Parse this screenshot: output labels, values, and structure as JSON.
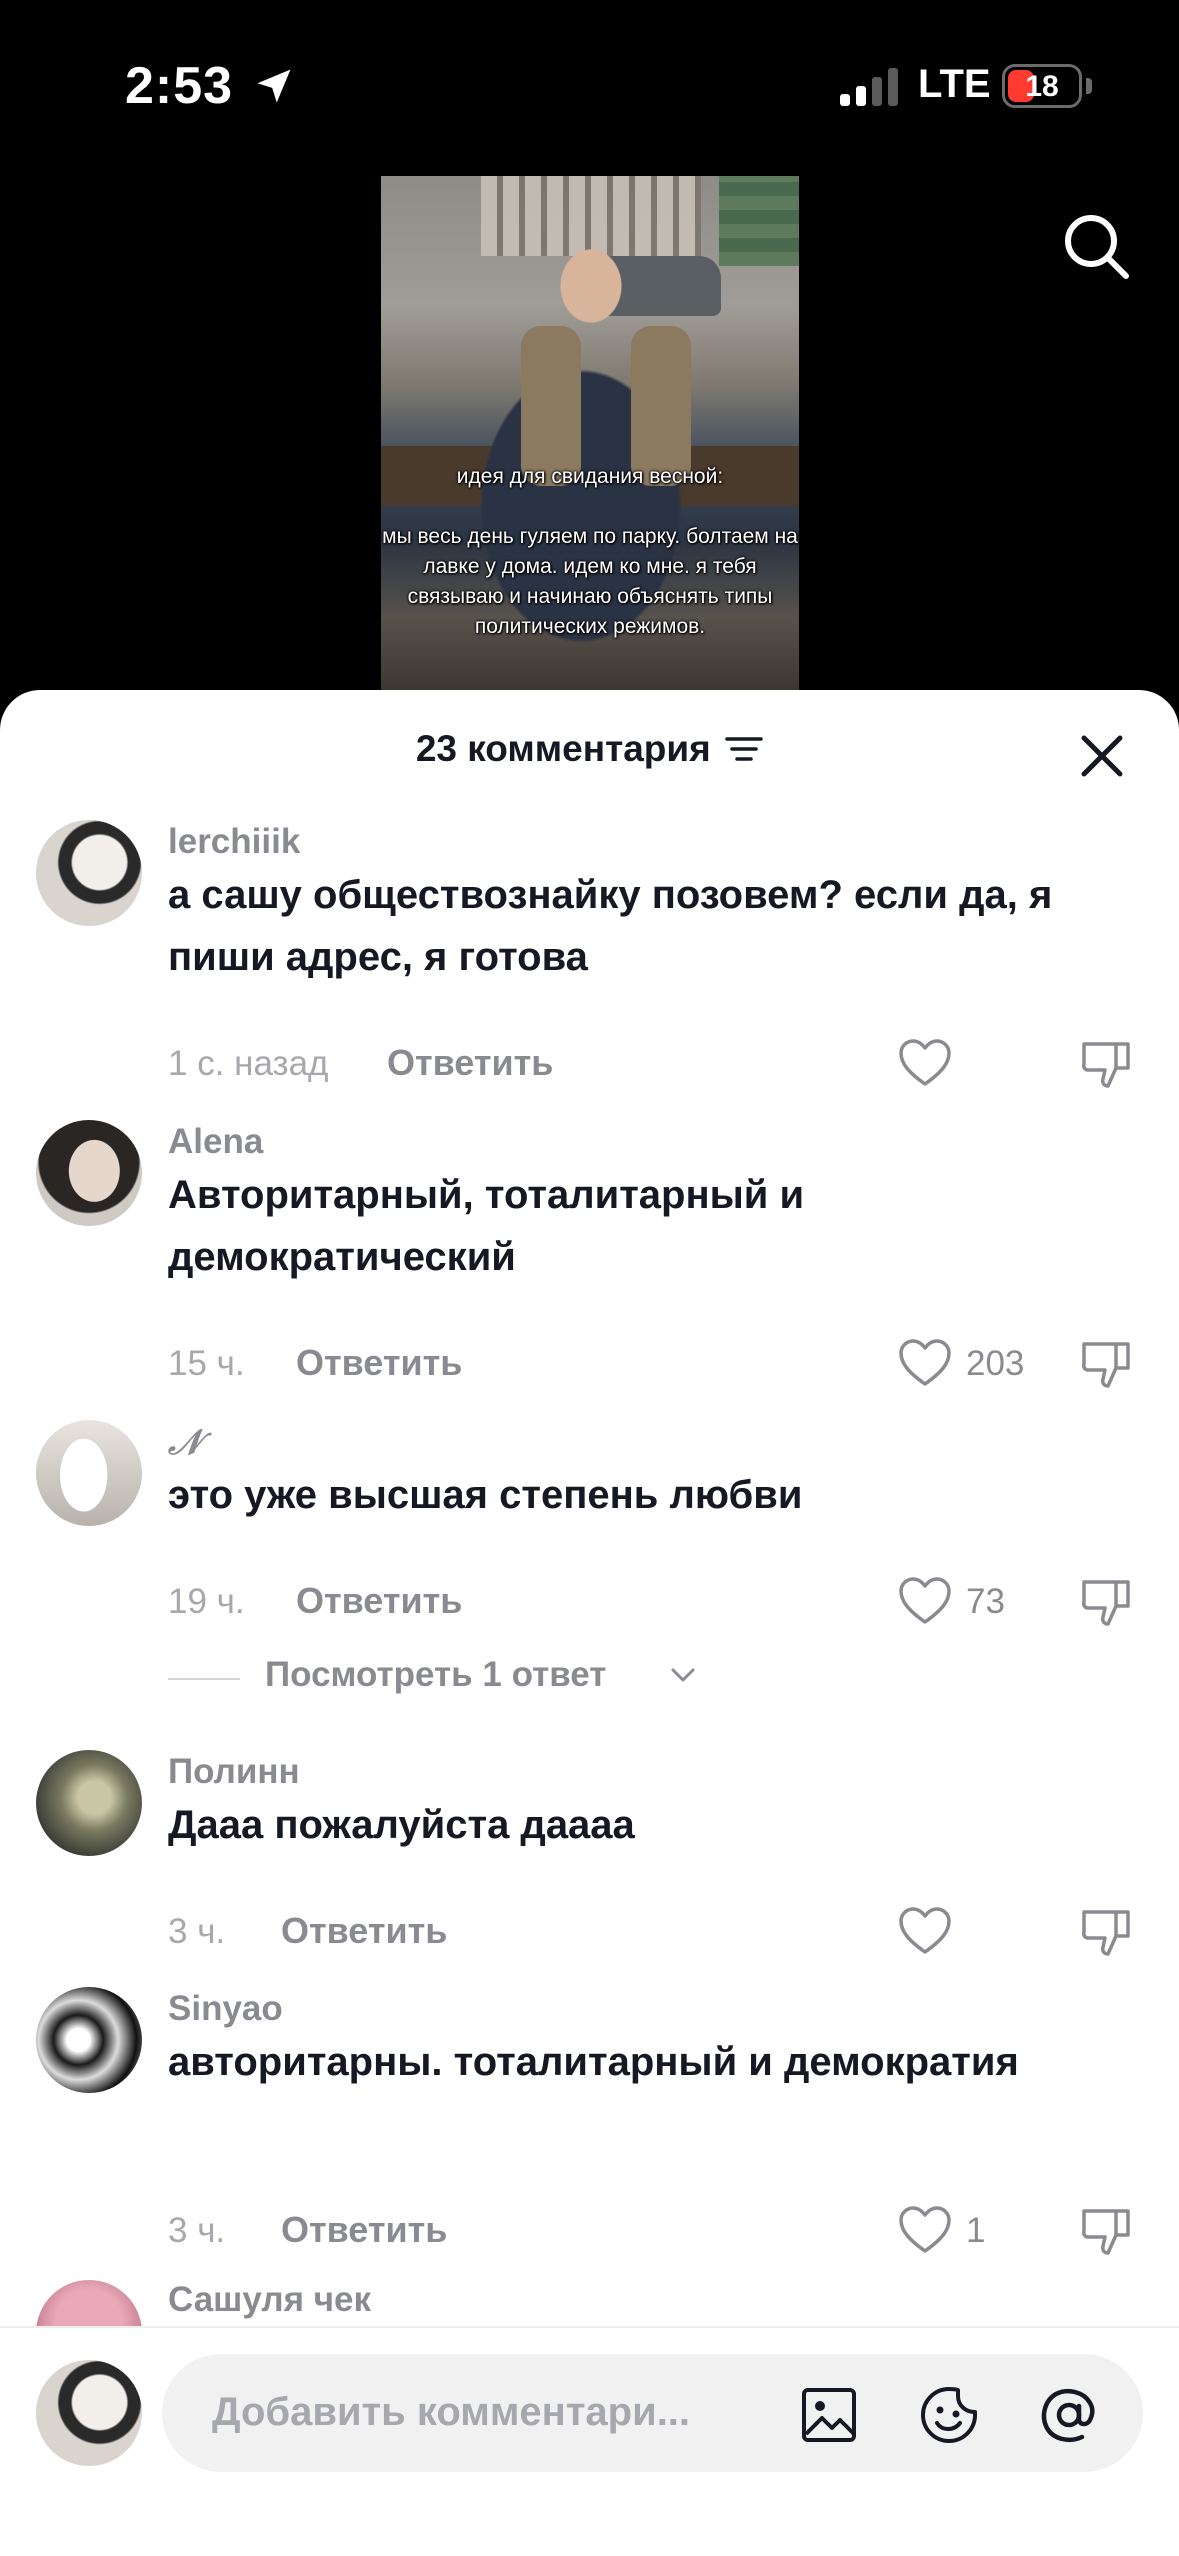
{
  "status_bar": {
    "time": "2:53",
    "network": "LTE",
    "battery": "18"
  },
  "video": {
    "caption_title": "идея для свидания весной:",
    "caption_body": "мы весь день гуляем по парку. болтаем на лавке у дома. идем ко мне. я тебя связываю и начинаю объяснять типы политических режимов."
  },
  "sheet": {
    "title": "23 комментария"
  },
  "comments": [
    {
      "username": "lerchiiik",
      "text": "а сашу обществознайку позовем? если да, я пиши адрес, я готова",
      "time": "1 с. назад",
      "reply": "Ответить",
      "likes": ""
    },
    {
      "username": "Alena",
      "text": "Авторитарный, тоталитарный и демократический",
      "time": "15 ч.",
      "reply": "Ответить",
      "likes": "203"
    },
    {
      "username": "𝒩",
      "text": "это уже высшая степень любви",
      "time": "19 ч.",
      "reply": "Ответить",
      "likes": "73",
      "view_replies": "Посмотреть 1 ответ"
    },
    {
      "username": "Полинн",
      "text": "Дааа пожалуйста даааа",
      "time": "3 ч.",
      "reply": "Ответить",
      "likes": ""
    },
    {
      "username": "Sinyao",
      "text": "авторитарны. тоталитарный и демократия",
      "time": "3 ч.",
      "reply": "Ответить",
      "likes": "1"
    },
    {
      "username": "Сашуля чек"
    }
  ],
  "input": {
    "placeholder": "Добавить комментари..."
  },
  "icons": [
    "location-arrow-icon",
    "signal-icon",
    "battery-icon",
    "search-icon",
    "filter-icon",
    "close-icon",
    "heart-icon",
    "dislike-icon",
    "chevron-down-icon",
    "image-icon",
    "emoji-icon",
    "mention-icon"
  ],
  "colors": {
    "text": "#161823",
    "muted": "#8a8b91",
    "battery_low": "#ff3b30"
  }
}
